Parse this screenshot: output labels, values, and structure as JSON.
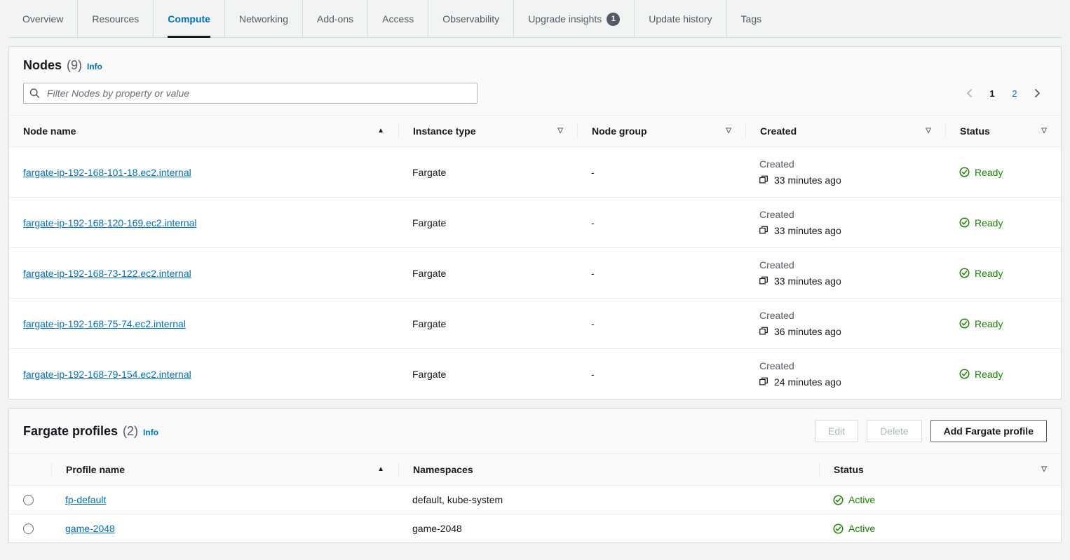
{
  "tabs": [
    {
      "label": "Overview",
      "active": false,
      "badge": null
    },
    {
      "label": "Resources",
      "active": false,
      "badge": null
    },
    {
      "label": "Compute",
      "active": true,
      "badge": null
    },
    {
      "label": "Networking",
      "active": false,
      "badge": null
    },
    {
      "label": "Add-ons",
      "active": false,
      "badge": null
    },
    {
      "label": "Access",
      "active": false,
      "badge": null
    },
    {
      "label": "Observability",
      "active": false,
      "badge": null
    },
    {
      "label": "Upgrade insights",
      "active": false,
      "badge": "1"
    },
    {
      "label": "Update history",
      "active": false,
      "badge": null
    },
    {
      "label": "Tags",
      "active": false,
      "badge": null
    }
  ],
  "nodes_panel": {
    "title": "Nodes",
    "count": "(9)",
    "info_label": "Info",
    "search": {
      "placeholder": "Filter Nodes by property or value",
      "value": "",
      "icon": "search-icon"
    },
    "pagination": {
      "prev_icon": "chevron-left-icon",
      "next_icon": "chevron-right-icon",
      "pages": [
        "1",
        "2"
      ],
      "current": "1"
    },
    "columns": [
      {
        "label": "Node name",
        "sort": "asc",
        "sort_icon": "sort-ascending-icon"
      },
      {
        "label": "Instance type",
        "sort": "none",
        "sort_icon": "sort-icon"
      },
      {
        "label": "Node group",
        "sort": "none",
        "sort_icon": "sort-icon"
      },
      {
        "label": "Created",
        "sort": "none",
        "sort_icon": "sort-icon"
      },
      {
        "label": "Status",
        "sort": "none",
        "sort_icon": "sort-icon"
      }
    ],
    "created_label": "Created",
    "rows": [
      {
        "node_name": "fargate-ip-192-168-101-18.ec2.internal",
        "instance_type": "Fargate",
        "node_group": "-",
        "created": "33 minutes ago",
        "status": "Ready"
      },
      {
        "node_name": "fargate-ip-192-168-120-169.ec2.internal",
        "instance_type": "Fargate",
        "node_group": "-",
        "created": "33 minutes ago",
        "status": "Ready"
      },
      {
        "node_name": "fargate-ip-192-168-73-122.ec2.internal",
        "instance_type": "Fargate",
        "node_group": "-",
        "created": "33 minutes ago",
        "status": "Ready"
      },
      {
        "node_name": "fargate-ip-192-168-75-74.ec2.internal",
        "instance_type": "Fargate",
        "node_group": "-",
        "created": "36 minutes ago",
        "status": "Ready"
      },
      {
        "node_name": "fargate-ip-192-168-79-154.ec2.internal",
        "instance_type": "Fargate",
        "node_group": "-",
        "created": "24 minutes ago",
        "status": "Ready"
      }
    ]
  },
  "fargate_panel": {
    "title": "Fargate profiles",
    "count": "(2)",
    "info_label": "Info",
    "buttons": {
      "edit": "Edit",
      "delete": "Delete",
      "add": "Add Fargate profile"
    },
    "columns": [
      {
        "label": "Profile name",
        "sort": "asc",
        "sort_icon": "sort-ascending-icon"
      },
      {
        "label": "Namespaces",
        "sort": "none",
        "sort_icon": null
      },
      {
        "label": "Status",
        "sort": "none",
        "sort_icon": "sort-icon"
      }
    ],
    "rows": [
      {
        "profile_name": "fp-default",
        "namespaces": "default, kube-system",
        "status": "Active"
      },
      {
        "profile_name": "game-2048",
        "namespaces": "game-2048",
        "status": "Active"
      }
    ]
  },
  "colors": {
    "link": "#0073bb",
    "success": "#1d8102",
    "page_bg": "#f2f3f3",
    "panel_bg": "#ffffff",
    "header_bg": "#fafafa",
    "border": "#d5dbdb",
    "badge_bg": "#545b64"
  }
}
